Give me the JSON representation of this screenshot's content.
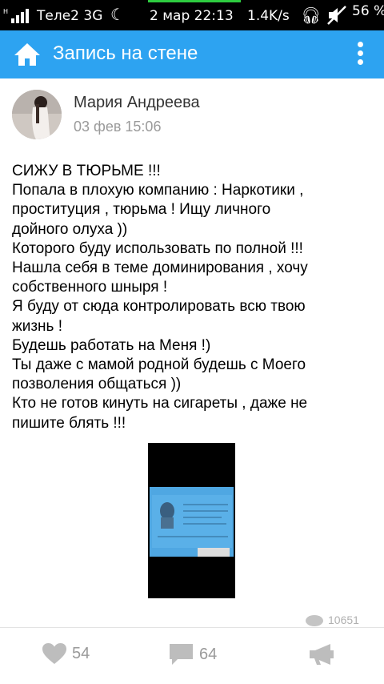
{
  "status_bar": {
    "carrier": "Теле2 3G",
    "datetime": "2 мар 22:13",
    "speed": "1.4K/s",
    "battery": "56 %"
  },
  "app_bar": {
    "title": "Запись на стене"
  },
  "post": {
    "author": "Мария Андреева",
    "date": "03 фев 15:06",
    "text_lines": [
      "СИЖУ В ТЮРЬМЕ !!!",
      "Попала в плохую компанию : Наркотики ,",
      "проституция , тюрьма ! Ищу личного",
      "дойного олуха ))",
      "Которого буду использовать по полной !!!",
      "Нашла себя в теме доминирования , хочу",
      "собственного шныря !",
      "Я буду от сюда контролировать всю твою",
      "жизнь !",
      "Будешь работать на Меня !)",
      "Ты даже с мамой родной будешь с Моего",
      "позволения общаться ))",
      "Кто не готов кинуть на сигареты , даже не",
      "пишите блять !!!"
    ],
    "views": "10651"
  },
  "actions": {
    "likes": "54",
    "comments": "64"
  },
  "colors": {
    "app_bar": "#2da3f1",
    "icon_gray": "#9a9a9a"
  },
  "icons": [
    "home-icon",
    "menu-dots-icon",
    "eye-icon",
    "heart-icon",
    "comment-icon",
    "megaphone-icon"
  ]
}
